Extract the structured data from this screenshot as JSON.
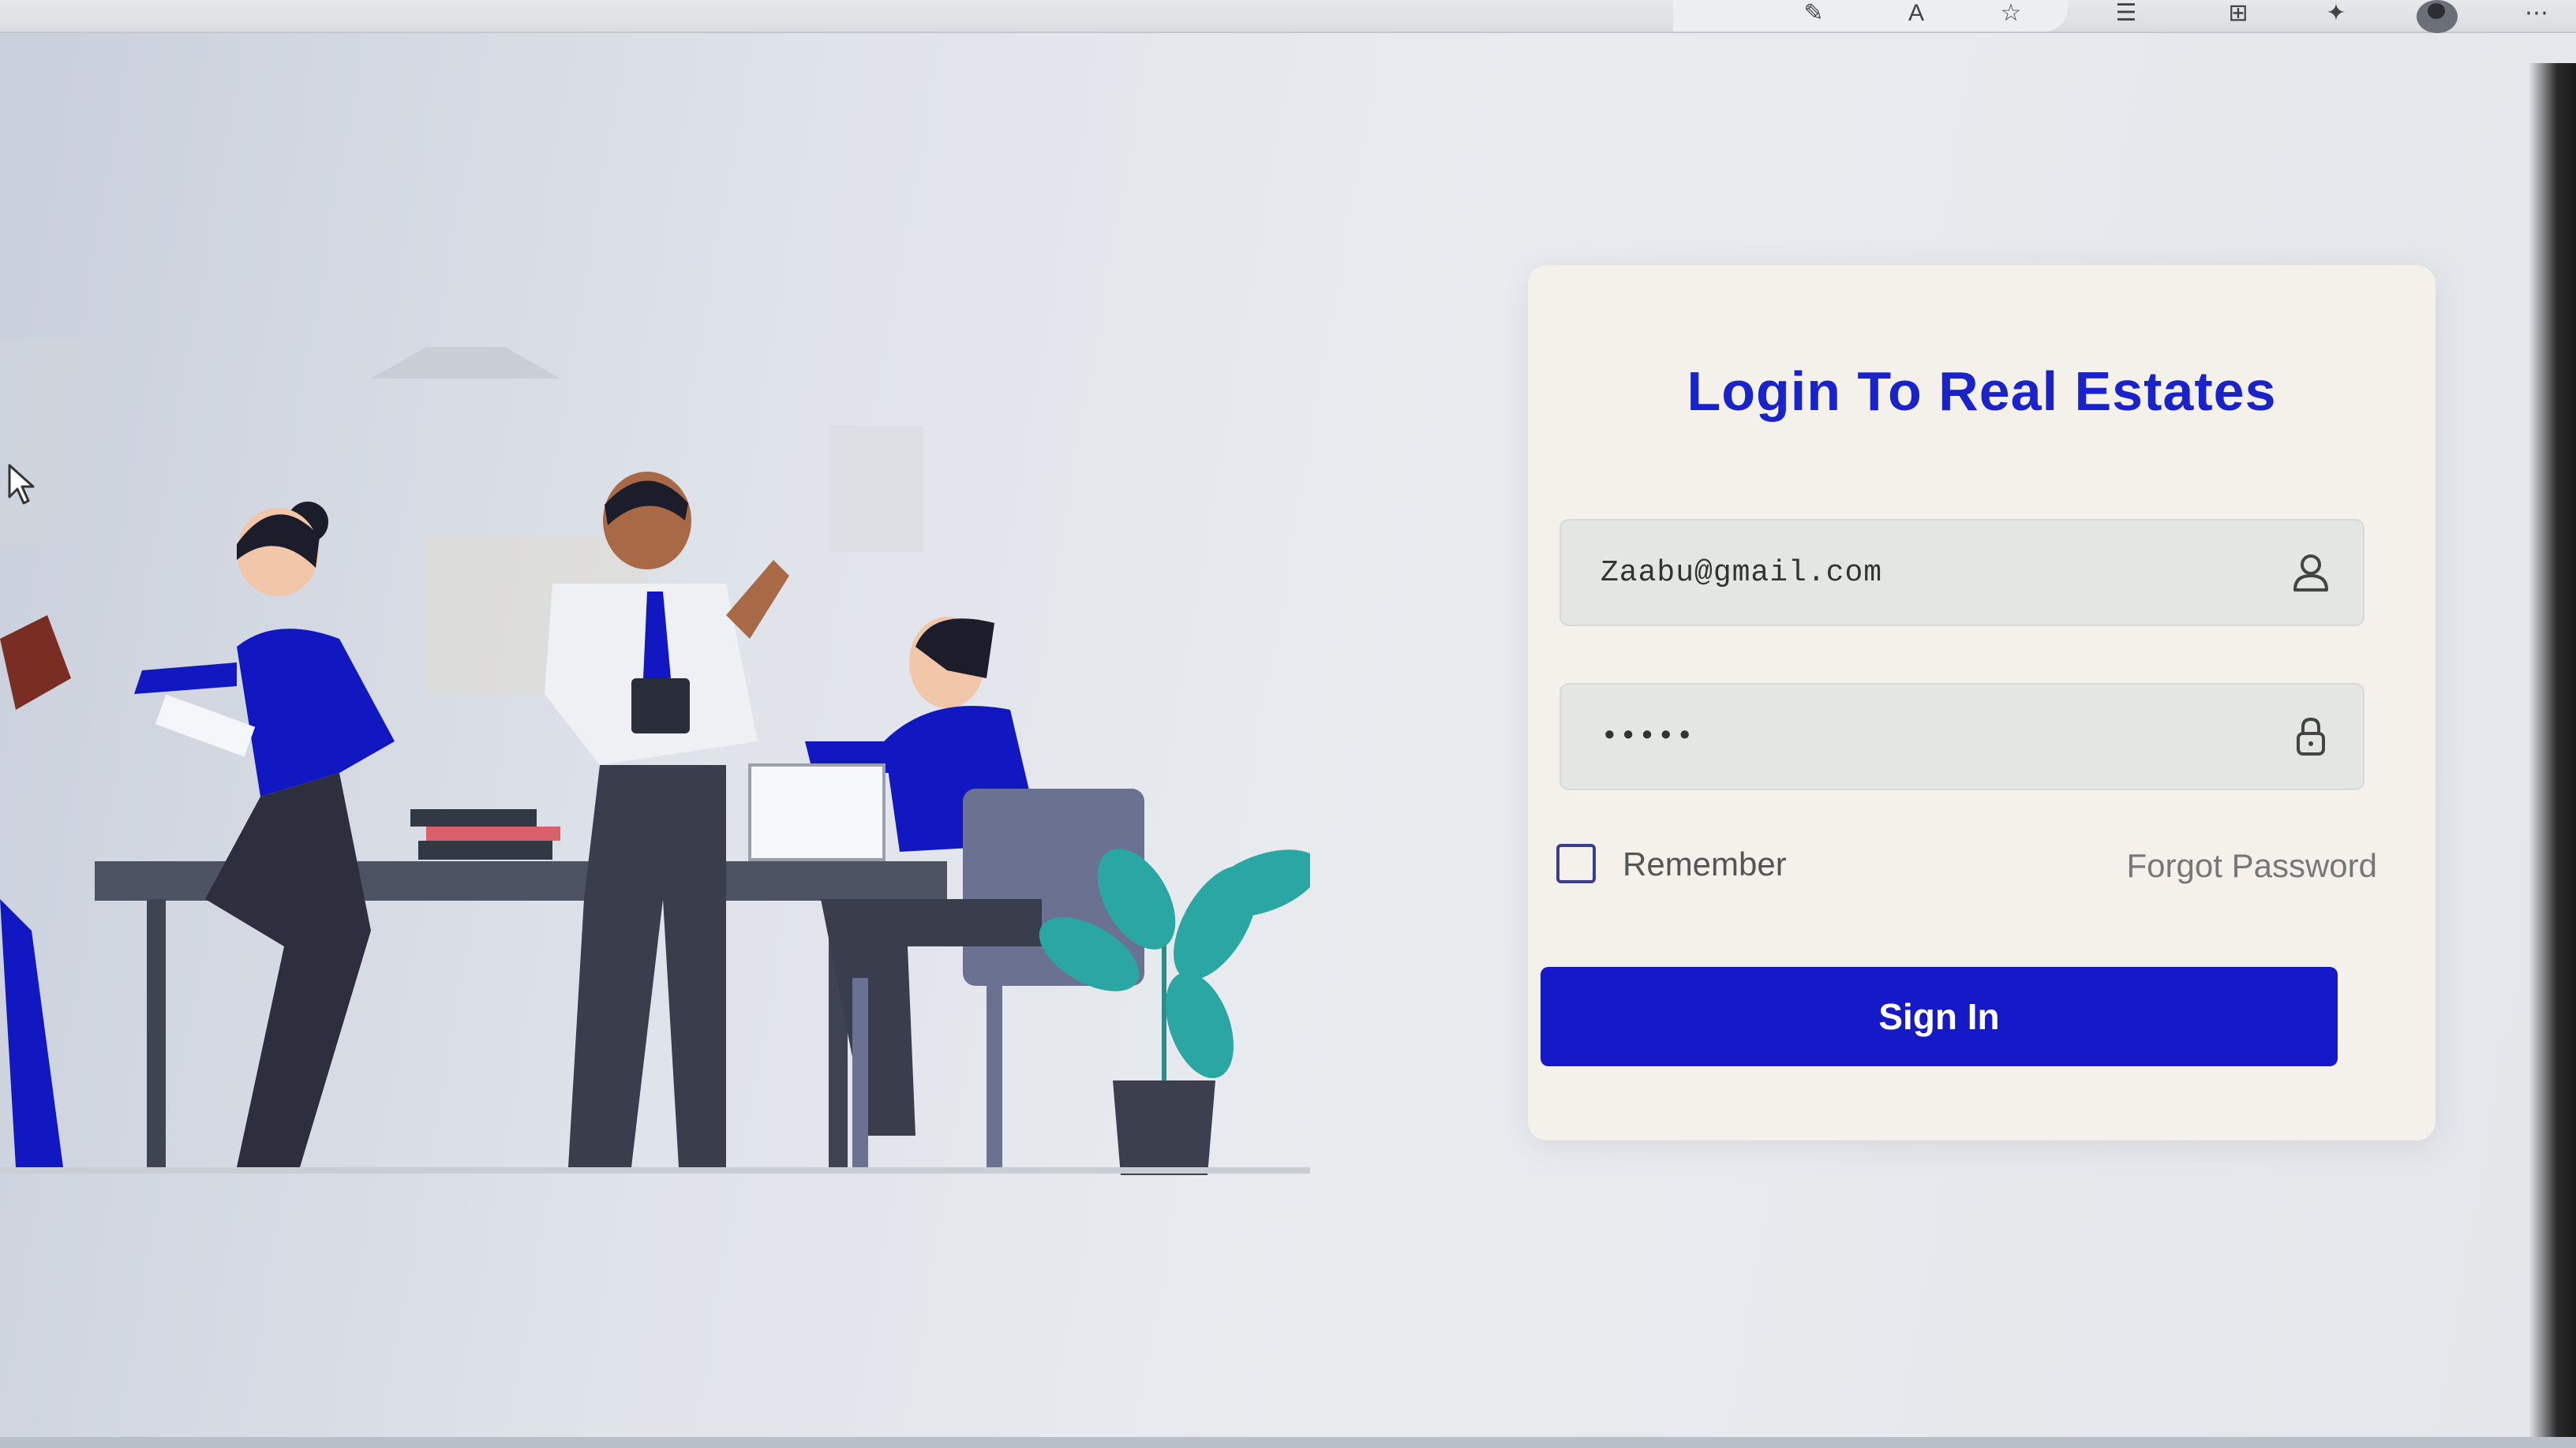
{
  "login": {
    "title": "Login To Real Estates",
    "email_value": "Zaabu@gmail.com",
    "password_value": "•••••",
    "remember_label": "Remember",
    "remember_checked": false,
    "forgot_label": "Forgot Password",
    "signin_label": "Sign In"
  },
  "icons": {
    "email_icon": "user-icon",
    "password_icon": "lock-icon"
  },
  "colors": {
    "accent": "#1519c8",
    "title": "#1a22c9",
    "card_bg": "#f3f1ea"
  }
}
